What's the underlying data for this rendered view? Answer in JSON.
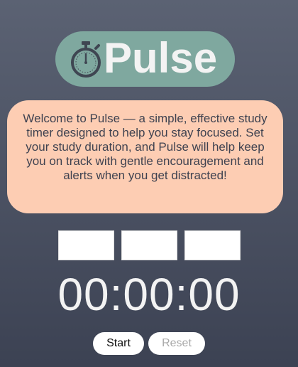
{
  "app": {
    "title": "Pulse",
    "logo_icon": "stopwatch-icon"
  },
  "intro": {
    "text": "Welcome to Pulse — a simple, effective study timer designed to help you stay focused. Set your study duration, and Pulse will help keep you on track with gentle encouragement and alerts when you get distracted!"
  },
  "inputs": {
    "hours_value": "",
    "minutes_value": "",
    "seconds_value": ""
  },
  "timer": {
    "display": "00:00:00"
  },
  "controls": {
    "start_label": "Start",
    "reset_label": "Reset"
  },
  "colors": {
    "background_top": "#5b6273",
    "background_bottom": "#3c4253",
    "logo_bg": "#7fa89f",
    "intro_bg": "#fdcdb3",
    "text_light": "#f3f3f3",
    "text_dark": "#3f4250",
    "reset_text": "#a9a9a9"
  }
}
